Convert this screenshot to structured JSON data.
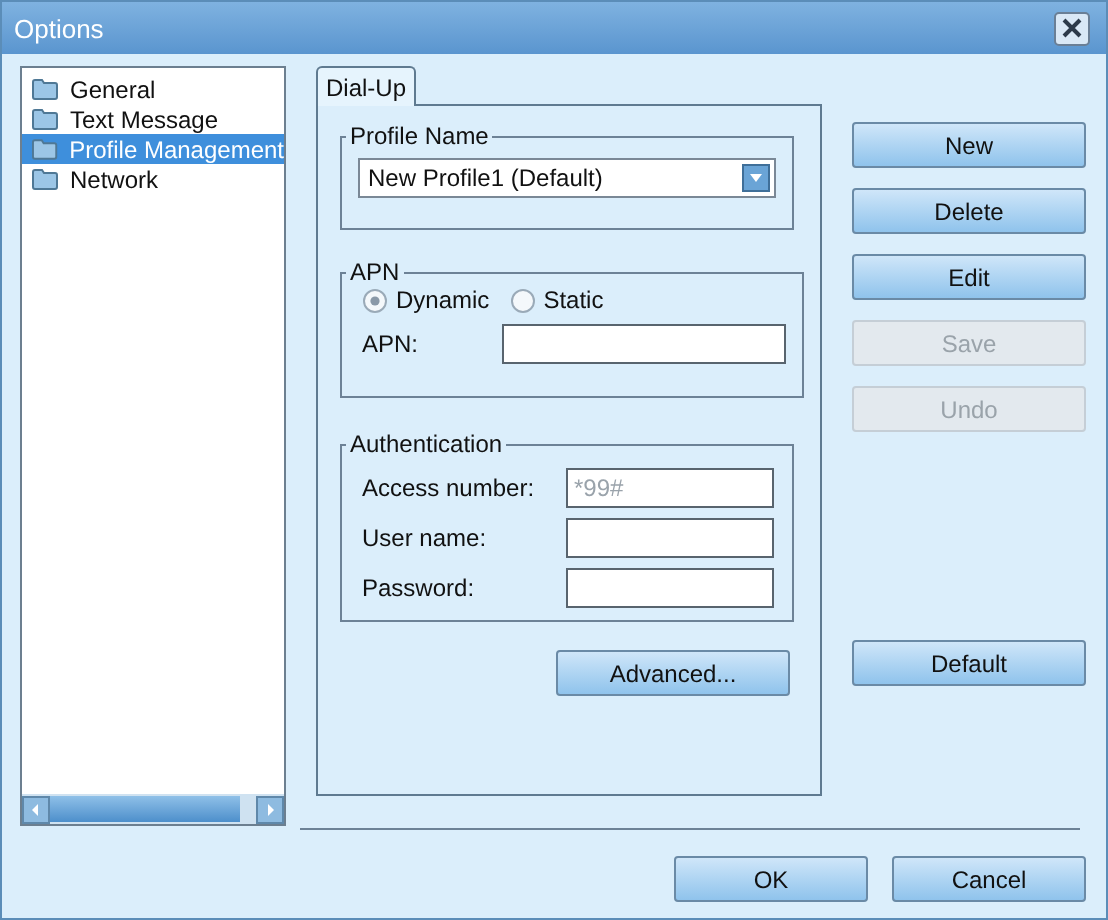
{
  "window": {
    "title": "Options"
  },
  "sidebar": {
    "items": [
      {
        "label": "General",
        "selected": false
      },
      {
        "label": "Text Message",
        "selected": false
      },
      {
        "label": "Profile Management",
        "selected": true
      },
      {
        "label": "Network",
        "selected": false
      }
    ]
  },
  "tabs": [
    {
      "label": "Dial-Up",
      "selected": true
    }
  ],
  "profile_name": {
    "legend": "Profile Name",
    "value": "New Profile1 (Default)"
  },
  "apn": {
    "legend": "APN",
    "options": [
      {
        "label": "Dynamic",
        "selected": true
      },
      {
        "label": "Static",
        "selected": false
      }
    ],
    "field_label": "APN:"
  },
  "authentication": {
    "legend": "Authentication",
    "fields": [
      {
        "label": "Access number:",
        "placeholder": "*99#"
      },
      {
        "label": "User name:"
      },
      {
        "label": "Password:"
      }
    ]
  },
  "advanced_button": "Advanced...",
  "side_buttons": [
    {
      "label": "New",
      "disabled": false
    },
    {
      "label": "Delete",
      "disabled": false
    },
    {
      "label": "Edit",
      "disabled": false
    },
    {
      "label": "Save",
      "disabled": true
    },
    {
      "label": "Undo",
      "disabled": true
    }
  ],
  "default_button": "Default",
  "footer_buttons": [
    "OK",
    "Cancel"
  ]
}
